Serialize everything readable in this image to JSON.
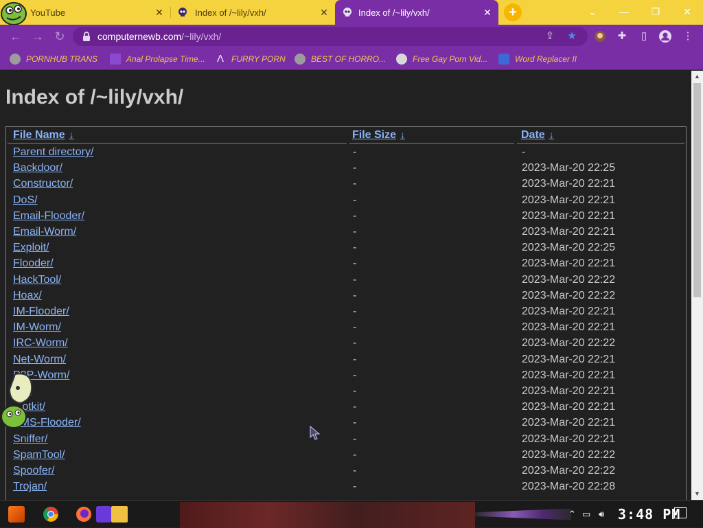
{
  "tabs": [
    {
      "title": "YouTube",
      "active": false
    },
    {
      "title": "Index of /~lily/vxh/",
      "active": false
    },
    {
      "title": "Index of /~lily/vxh/",
      "active": true
    }
  ],
  "toolbar": {
    "url_host": "computernewb.com",
    "url_path": "/~lily/vxh/"
  },
  "bookmarks": [
    {
      "label": "PORNHUB TRANS",
      "icon": "globe-icon"
    },
    {
      "label": "Anal Prolapse Time...",
      "icon": "sigma-icon"
    },
    {
      "label": "FURRY PORN",
      "icon": "lambda-icon"
    },
    {
      "label": "BEST OF HORRO...",
      "icon": "globe-icon"
    },
    {
      "label": "Free Gay Porn Vid...",
      "icon": "skull-icon"
    },
    {
      "label": "Word Replacer II",
      "icon": "wr-icon"
    }
  ],
  "page": {
    "title": "Index of /~lily/vxh/",
    "columns": {
      "name": "File Name",
      "size": "File Size",
      "date": "Date",
      "sort_arrow": "↓"
    },
    "rows": [
      {
        "name": "Parent directory/",
        "size": "-",
        "date": "-"
      },
      {
        "name": "Backdoor/",
        "size": "-",
        "date": "2023-Mar-20 22:25"
      },
      {
        "name": "Constructor/",
        "size": "-",
        "date": "2023-Mar-20 22:21"
      },
      {
        "name": "DoS/",
        "size": "-",
        "date": "2023-Mar-20 22:21"
      },
      {
        "name": "Email-Flooder/",
        "size": "-",
        "date": "2023-Mar-20 22:21"
      },
      {
        "name": "Email-Worm/",
        "size": "-",
        "date": "2023-Mar-20 22:21"
      },
      {
        "name": "Exploit/",
        "size": "-",
        "date": "2023-Mar-20 22:25"
      },
      {
        "name": "Flooder/",
        "size": "-",
        "date": "2023-Mar-20 22:21"
      },
      {
        "name": "HackTool/",
        "size": "-",
        "date": "2023-Mar-20 22:22"
      },
      {
        "name": "Hoax/",
        "size": "-",
        "date": "2023-Mar-20 22:22"
      },
      {
        "name": "IM-Flooder/",
        "size": "-",
        "date": "2023-Mar-20 22:21"
      },
      {
        "name": "IM-Worm/",
        "size": "-",
        "date": "2023-Mar-20 22:21"
      },
      {
        "name": "IRC-Worm/",
        "size": "-",
        "date": "2023-Mar-20 22:22"
      },
      {
        "name": "Net-Worm/",
        "size": "-",
        "date": "2023-Mar-20 22:21"
      },
      {
        "name": "P2P-Worm/",
        "size": "-",
        "date": "2023-Mar-20 22:21"
      },
      {
        "name": "...d/",
        "size": "-",
        "date": "2023-Mar-20 22:21"
      },
      {
        "name": "...otkit/",
        "size": "-",
        "date": "2023-Mar-20 22:21"
      },
      {
        "name": "SMS-Flooder/",
        "size": "-",
        "date": "2023-Mar-20 22:21"
      },
      {
        "name": "Sniffer/",
        "size": "-",
        "date": "2023-Mar-20 22:21"
      },
      {
        "name": "SpamTool/",
        "size": "-",
        "date": "2023-Mar-20 22:22"
      },
      {
        "name": "Spoofer/",
        "size": "-",
        "date": "2023-Mar-20 22:22"
      },
      {
        "name": "Trojan/",
        "size": "-",
        "date": "2023-Mar-20 22:28"
      }
    ]
  },
  "taskbar": {
    "clock": "3:48 PM"
  },
  "colors": {
    "tabstrip": "#f5d33e",
    "active_tab": "#7a2ea6",
    "page_bg": "#212121",
    "link": "#8ab4f8",
    "bookmark_text": "#f0c64b"
  }
}
